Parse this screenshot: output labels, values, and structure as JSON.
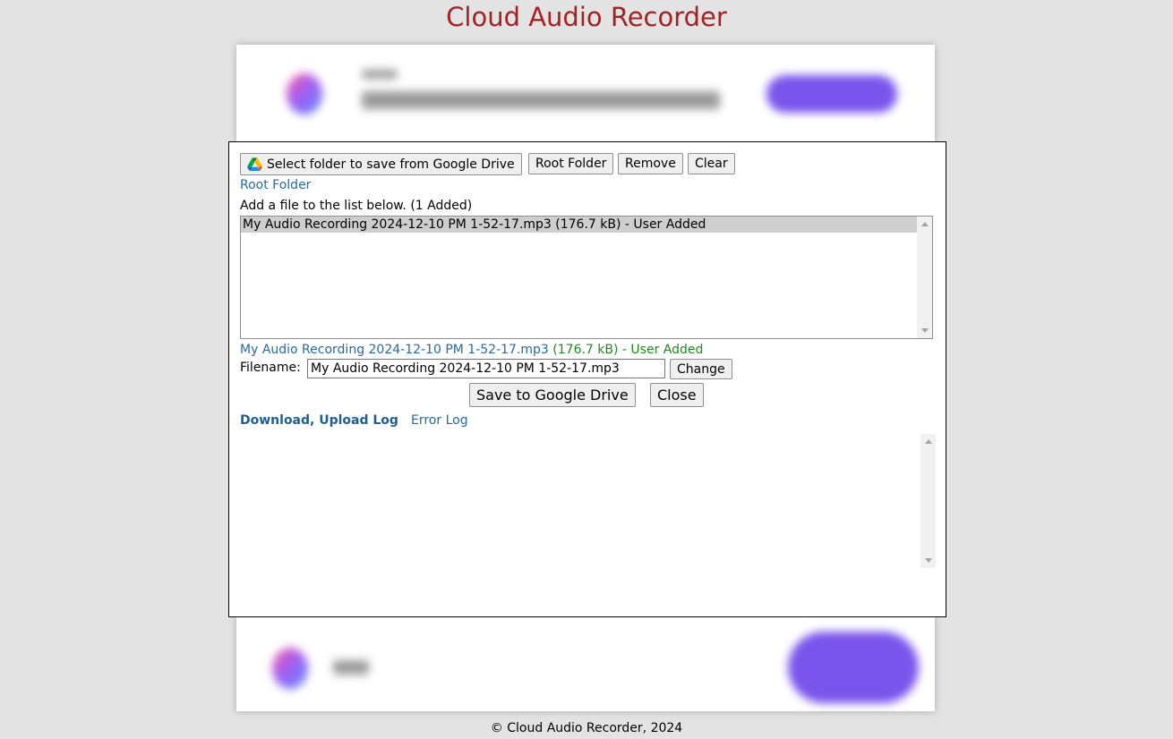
{
  "app": {
    "title": "Cloud Audio Recorder"
  },
  "dialog": {
    "toolbar": {
      "select_folder_label": "Select folder to save from Google Drive",
      "select_folder_icon": "google-drive-icon",
      "root_folder_label": "Root Folder",
      "remove_label": "Remove",
      "clear_label": "Clear"
    },
    "current_folder": "Root Folder",
    "list_instruction": "Add a file to the list below. (1 Added)",
    "file_list": [
      {
        "label": "My Audio Recording 2024-12-10 PM 1-52-17.mp3 (176.7 kB) - User Added",
        "selected": true
      }
    ],
    "selected_file": {
      "name": "My Audio Recording 2024-12-10 PM 1-52-17.mp3",
      "details": "(176.7 kB) - User Added"
    },
    "filename_label": "Filename:",
    "filename_value": "My Audio Recording 2024-12-10 PM 1-52-17.mp3",
    "change_label": "Change",
    "save_label": "Save to Google Drive",
    "close_label": "Close",
    "log_tabs": [
      {
        "label": "Download, Upload Log",
        "active": true
      },
      {
        "label": "Error Log",
        "active": false
      }
    ]
  },
  "footer": {
    "text": "© Cloud Audio Recorder, 2024"
  },
  "colors": {
    "title": "#a52222",
    "link": "#2a6a9c",
    "status_green": "#1f8a1f",
    "ad_button": "#7a55ec"
  }
}
